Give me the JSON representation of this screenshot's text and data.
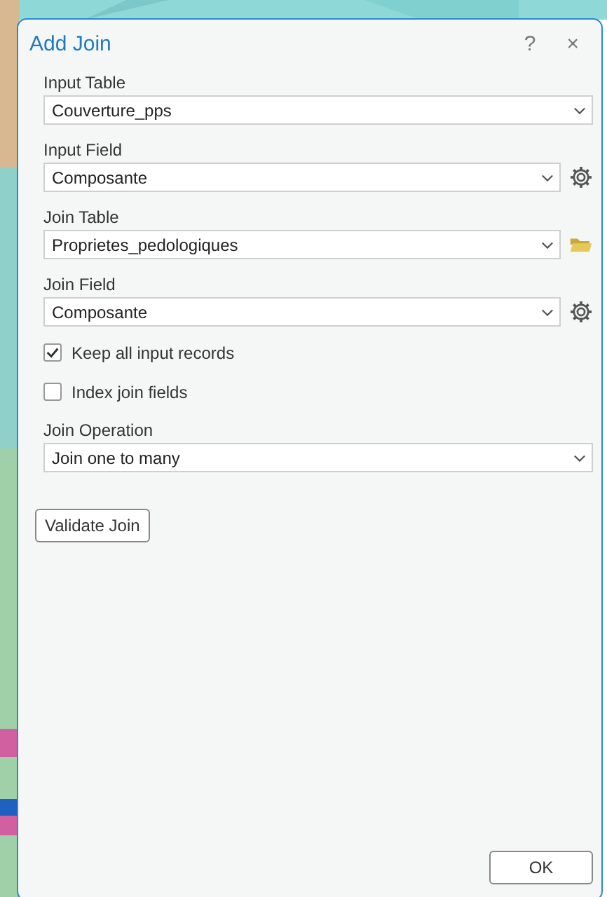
{
  "window": {
    "title": "Add Join",
    "help": "?",
    "close": "×"
  },
  "parameters": [
    {
      "kind": "dropdown",
      "label": "Input Table",
      "value": "Couverture_pps"
    },
    {
      "kind": "dropdown",
      "label": "Input Field",
      "value": "Composante",
      "tool": {
        "kind": "gear"
      }
    },
    {
      "kind": "dropdown",
      "label": "Join Table",
      "value": "Proprietes_pedologiques",
      "tool": {
        "kind": "folder"
      }
    },
    {
      "kind": "dropdown",
      "label": "Join Field",
      "value": "Composante",
      "tool": {
        "kind": "gear"
      }
    },
    {
      "kind": "checkbox",
      "label": "Keep all input records",
      "checked": true
    },
    {
      "kind": "checkbox",
      "label": "Index join fields",
      "checked": false
    },
    {
      "kind": "dropdown",
      "label": "Join Operation",
      "value": "Join one to many"
    }
  ],
  "validate_button": "Validate Join",
  "ok_button": "OK"
}
